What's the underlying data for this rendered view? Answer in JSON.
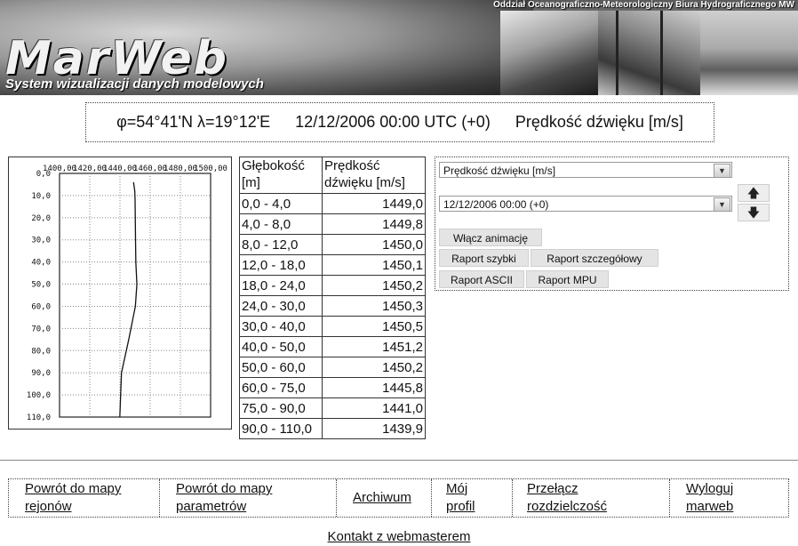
{
  "header": {
    "org": "Oddział Oceanograficzno-Meteorologiczny Biura Hydrograficznego MW",
    "logo": "MarWeb",
    "subtitle": "System wizualizacji danych modelowych"
  },
  "info": {
    "coords": "φ=54°41'N λ=19°12'E",
    "datetime": "12/12/2006 00:00 UTC (+0)",
    "param": "Prędkość dźwięku [m/s]"
  },
  "chart_data": {
    "type": "line",
    "xlabel": "",
    "ylabel": "",
    "xlim": [
      1400,
      1500
    ],
    "ylim": [
      0,
      110
    ],
    "x_ticks": [
      "1400,00",
      "1420,00",
      "1440,00",
      "1460,00",
      "1480,00",
      "1500,00"
    ],
    "y_ticks": [
      "0,0",
      "10,0",
      "20,0",
      "30,0",
      "40,0",
      "50,0",
      "60,0",
      "70,0",
      "80,0",
      "90,0",
      "100,0",
      "110,0"
    ],
    "x_tick_values": [
      1400,
      1420,
      1440,
      1460,
      1480,
      1500
    ],
    "y_tick_values": [
      0,
      10,
      20,
      30,
      40,
      50,
      60,
      70,
      80,
      90,
      100,
      110
    ],
    "series": [
      {
        "x": [
          1449.0,
          1449.8,
          1450.0,
          1450.1,
          1450.2,
          1450.3,
          1450.5,
          1451.2,
          1450.2,
          1445.8,
          1441.0,
          1439.9
        ],
        "y": [
          4,
          8,
          12,
          18,
          24,
          30,
          40,
          50,
          60,
          75,
          90,
          110
        ]
      }
    ],
    "grid": true
  },
  "table": {
    "headers": [
      "Głębokość [m]",
      "Prędkość dźwięku [m/s]"
    ],
    "rows": [
      [
        "0,0 - 4,0",
        "1449,0"
      ],
      [
        "4,0 - 8,0",
        "1449,8"
      ],
      [
        "8,0 - 12,0",
        "1450,0"
      ],
      [
        "12,0 - 18,0",
        "1450,1"
      ],
      [
        "18,0 - 24,0",
        "1450,2"
      ],
      [
        "24,0 - 30,0",
        "1450,3"
      ],
      [
        "30,0 - 40,0",
        "1450,5"
      ],
      [
        "40,0 - 50,0",
        "1451,2"
      ],
      [
        "50,0 - 60,0",
        "1450,2"
      ],
      [
        "60,0 - 75,0",
        "1445,8"
      ],
      [
        "75,0 - 90,0",
        "1441,0"
      ],
      [
        "90,0 - 110,0",
        "1439,9"
      ]
    ]
  },
  "controls": {
    "param_select": "Prędkość dźwięku [m/s]",
    "date_select": "12/12/2006 00:00 (+0)",
    "animation_button": "Włącz animację",
    "quick_report": "Raport szybki",
    "detailed_report": "Raport szczegółowy",
    "ascii_report": "Raport ASCII",
    "mpu_report": "Raport MPU",
    "up_icon": "arrow-up-icon",
    "down_icon": "arrow-down-icon"
  },
  "footer": {
    "nav": [
      {
        "line1": "Powrót do mapy",
        "line2": "rejonów"
      },
      {
        "line1": "Powrót do mapy",
        "line2": "parametrów"
      },
      {
        "line1": "Archiwum",
        "line2": ""
      },
      {
        "line1": "Mój",
        "line2": "profil"
      },
      {
        "line1": "Przełącz",
        "line2": "rozdzielczość"
      },
      {
        "line1": "Wyloguj",
        "line2": "marweb"
      }
    ],
    "contact": "Kontakt z webmasterem"
  }
}
